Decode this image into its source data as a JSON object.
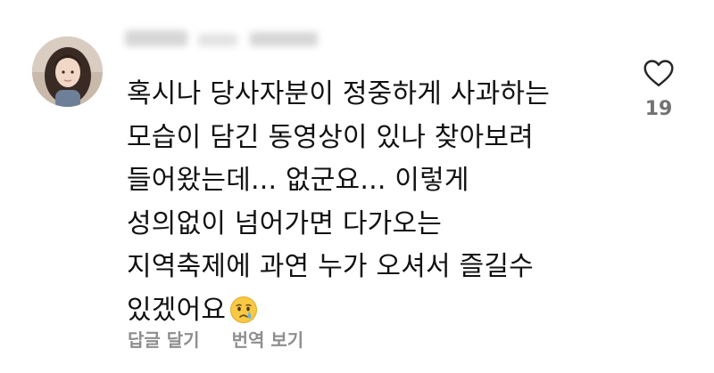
{
  "comment": {
    "author_name": "",
    "lines": [
      "혹시나 당사자분이 정중하게 사과하는",
      "모습이 담긴 동영상이 있나 찾아보려",
      "들어왔는데... 없군요... 이렇게",
      "성의없이 넘어가면 다가오는",
      "지역축제에 과연 누가 오셔서 즐길수",
      "있겠어요"
    ],
    "trailing_emoji": "crying-face"
  },
  "actions": {
    "reply_label": "답글 달기",
    "translate_label": "번역 보기"
  },
  "like": {
    "icon": "heart-outline-icon",
    "count": "19"
  },
  "colors": {
    "text": "#111111",
    "secondary": "#8e8e8e",
    "like_count": "#737373",
    "icon_stroke": "#262626"
  }
}
